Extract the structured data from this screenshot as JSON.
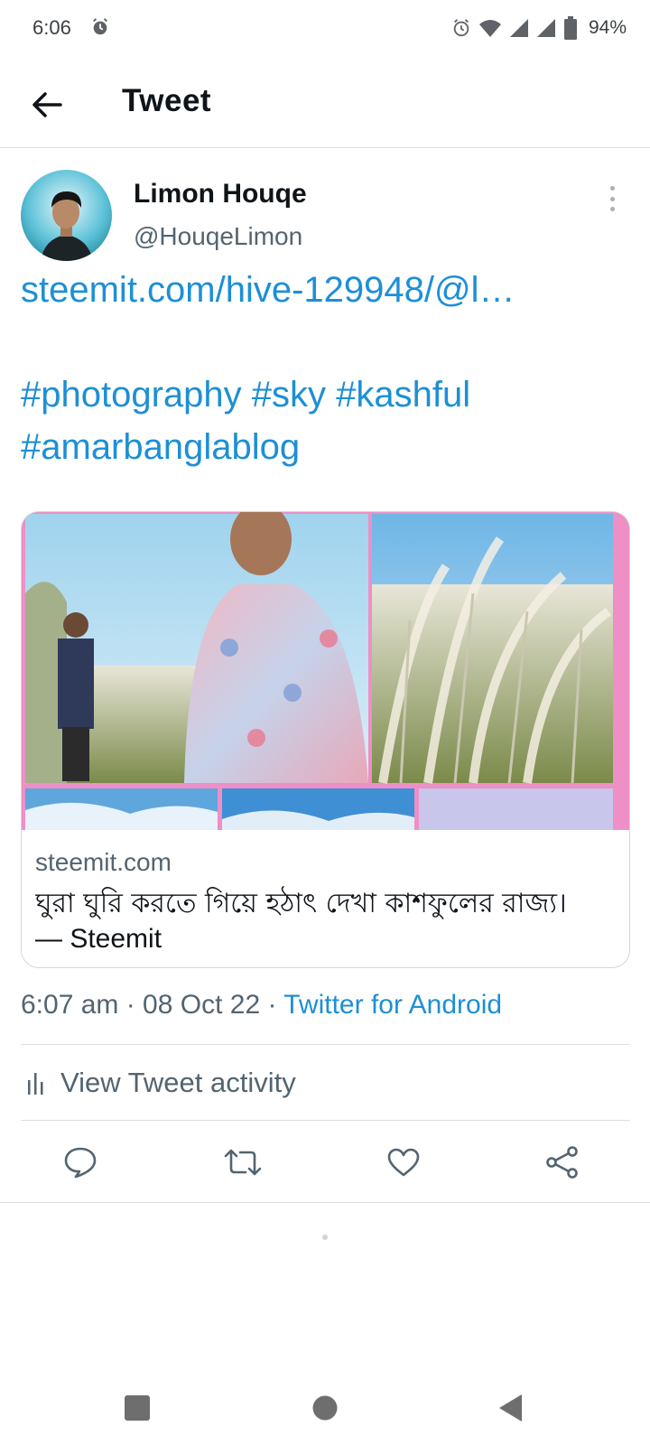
{
  "status_bar": {
    "time": "6:06",
    "battery": "94%"
  },
  "app_bar": {
    "title": "Tweet"
  },
  "tweet": {
    "author_name": "Limon Houqe",
    "author_handle": "@HouqeLimon",
    "link_text": "steemit.com/hive-129948/@l…",
    "hashtags_line1": [
      "#photography",
      "#sky",
      "#kashful"
    ],
    "hashtags_line2": [
      "#amarbanglablog"
    ],
    "card": {
      "domain": "steemit.com",
      "title": "ঘুরা ঘুরি করতে গিয়ে হঠাৎ দেখা কাশফুলের রাজ্য।",
      "subtitle": "— Steemit"
    },
    "timestamp": "6:07 am · 08 Oct 22 · ",
    "source": "Twitter for Android",
    "activity_label": "View Tweet activity"
  },
  "icons": {
    "back": "arrow-left-icon",
    "more": "more-vertical-icon",
    "reply": "reply-icon",
    "retweet": "retweet-icon",
    "like": "heart-icon",
    "share": "share-icon",
    "activity": "bar-chart-icon"
  },
  "colors": {
    "accent": "#1d8fd6",
    "text_primary": "#0f1419",
    "text_secondary": "#536471",
    "divider": "#dcdfe3"
  }
}
